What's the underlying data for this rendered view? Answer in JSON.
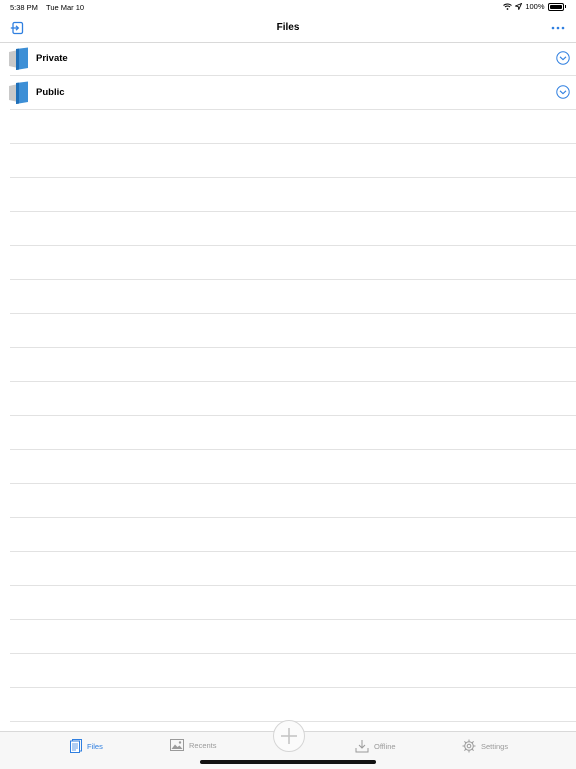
{
  "status_bar": {
    "time": "5:38 PM",
    "date": "Tue Mar 10",
    "battery": "100%",
    "battery_level": 1.0
  },
  "nav": {
    "title": "Files",
    "left_icon": "login-icon",
    "right_icon": "more-icon"
  },
  "folders": [
    {
      "label": "Private",
      "icon": "folder-icon"
    },
    {
      "label": "Public",
      "icon": "folder-icon"
    }
  ],
  "tabs": {
    "files": "Files",
    "recents": "Recents",
    "offline": "Offline",
    "settings": "Settings"
  },
  "colors": {
    "accent": "#2f7fe0",
    "inactive": "#9a9a9a",
    "separator": "#e2e2e2"
  }
}
